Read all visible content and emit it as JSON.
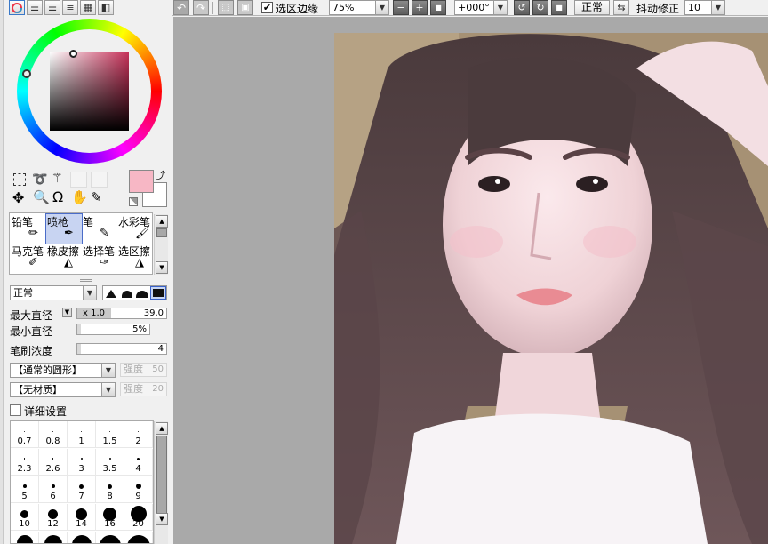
{
  "top_toolbar": {
    "selection_edge_label": "选区边缘",
    "selection_edge_checked": true,
    "zoom_value": "75%",
    "rotation_value": "+000°",
    "blend_mode_value": "正常",
    "stabilizer_label": "抖动修正",
    "stabilizer_value": "10"
  },
  "color": {
    "primary": "#f7b7c5",
    "secondary": "#ffffff",
    "square_hue": "#c8325a"
  },
  "brush_tools": [
    {
      "label": "铅笔",
      "icon": "pencil-icon",
      "selected": false
    },
    {
      "label": "喷枪",
      "icon": "airbrush-icon",
      "selected": true
    },
    {
      "label": "笔",
      "icon": "pen-icon",
      "selected": false
    },
    {
      "label": "水彩笔",
      "icon": "watercolor-icon",
      "selected": false
    },
    {
      "label": "马克笔",
      "icon": "marker-icon",
      "selected": false
    },
    {
      "label": "橡皮擦",
      "icon": "eraser-icon",
      "selected": false
    },
    {
      "label": "选择笔",
      "icon": "select-pen-icon",
      "selected": false
    },
    {
      "label": "选区擦",
      "icon": "select-eraser-icon",
      "selected": false
    }
  ],
  "brush_settings": {
    "blend_mode": "正常",
    "max_size_label": "最大直径",
    "max_size_multiplier": "x 1.0",
    "max_size_value": "39.0",
    "min_size_label": "最小直径",
    "min_size_value": "5%",
    "min_size_fraction": 0.05,
    "density_label": "笔刷浓度",
    "density_value": "4",
    "density_fraction": 0.04,
    "shape_value": "【通常的圆形】",
    "shape_strength_label": "强度",
    "shape_strength_value": "50",
    "texture_value": "【无材质】",
    "texture_strength_label": "强度",
    "texture_strength_value": "20",
    "advanced_label": "详细设置",
    "advanced_checked": false
  },
  "size_presets": [
    "0.7",
    "0.8",
    "1",
    "1.5",
    "2",
    "2.3",
    "2.6",
    "3",
    "3.5",
    "4",
    "5",
    "6",
    "7",
    "8",
    "9",
    "10",
    "12",
    "14",
    "16",
    "20"
  ],
  "canvas": {
    "background": "#a9a9a9"
  }
}
